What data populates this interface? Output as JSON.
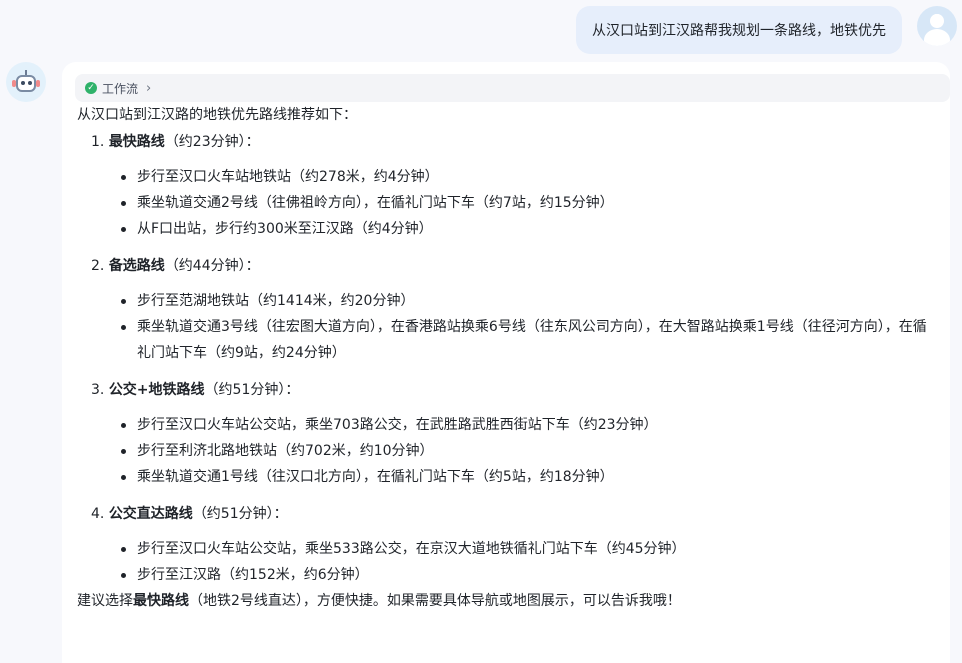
{
  "user_message": "从汉口站到江汉路帮我规划一条路线，地铁优先",
  "workflow_label": "工作流",
  "intro": "从汉口站到江汉路的地铁优先路线推荐如下：",
  "routes": [
    {
      "number": "1.",
      "title": "最快路线",
      "duration": "（约23分钟）：",
      "steps": [
        "步行至汉口火车站地铁站（约278米，约4分钟）",
        "乘坐轨道交通2号线（往佛祖岭方向），在循礼门站下车（约7站，约15分钟）",
        "从F口出站，步行约300米至江汉路（约4分钟）"
      ]
    },
    {
      "number": "2.",
      "title": "备选路线",
      "duration": "（约44分钟）：",
      "steps": [
        "步行至范湖地铁站（约1414米，约20分钟）",
        "乘坐轨道交通3号线（往宏图大道方向），在香港路站换乘6号线（往东风公司方向），在大智路站换乘1号线（往径河方向），在循礼门站下车（约9站，约24分钟）"
      ]
    },
    {
      "number": "3.",
      "title": "公交+地铁路线",
      "duration": "（约51分钟）：",
      "steps": [
        "步行至汉口火车站公交站，乘坐703路公交，在武胜路武胜西街站下车（约23分钟）",
        "步行至利济北路地铁站（约702米，约10分钟）",
        "乘坐轨道交通1号线（往汉口北方向），在循礼门站下车（约5站，约18分钟）"
      ]
    },
    {
      "number": "4.",
      "title": "公交直达路线",
      "duration": "（约51分钟）：",
      "steps": [
        "步行至汉口火车站公交站，乘坐533路公交，在京汉大道地铁循礼门站下车（约45分钟）",
        "步行至江汉路（约152米，约6分钟）"
      ]
    }
  ],
  "summary": {
    "prefix": "建议选择",
    "highlight": "最快路线",
    "suffix": "（地铁2号线直达），方便快捷。如果需要具体导航或地图展示，可以告诉我哦！"
  },
  "icons": {
    "workflow_status": "check-circle-icon",
    "workflow_expand": "chevron-right-icon",
    "user_avatar": "user-avatar-icon",
    "bot_avatar": "robot-avatar-icon"
  },
  "colors": {
    "user_bubble": "#e6eefb",
    "check": "#2fb26a",
    "background": "#f7f8fc"
  }
}
